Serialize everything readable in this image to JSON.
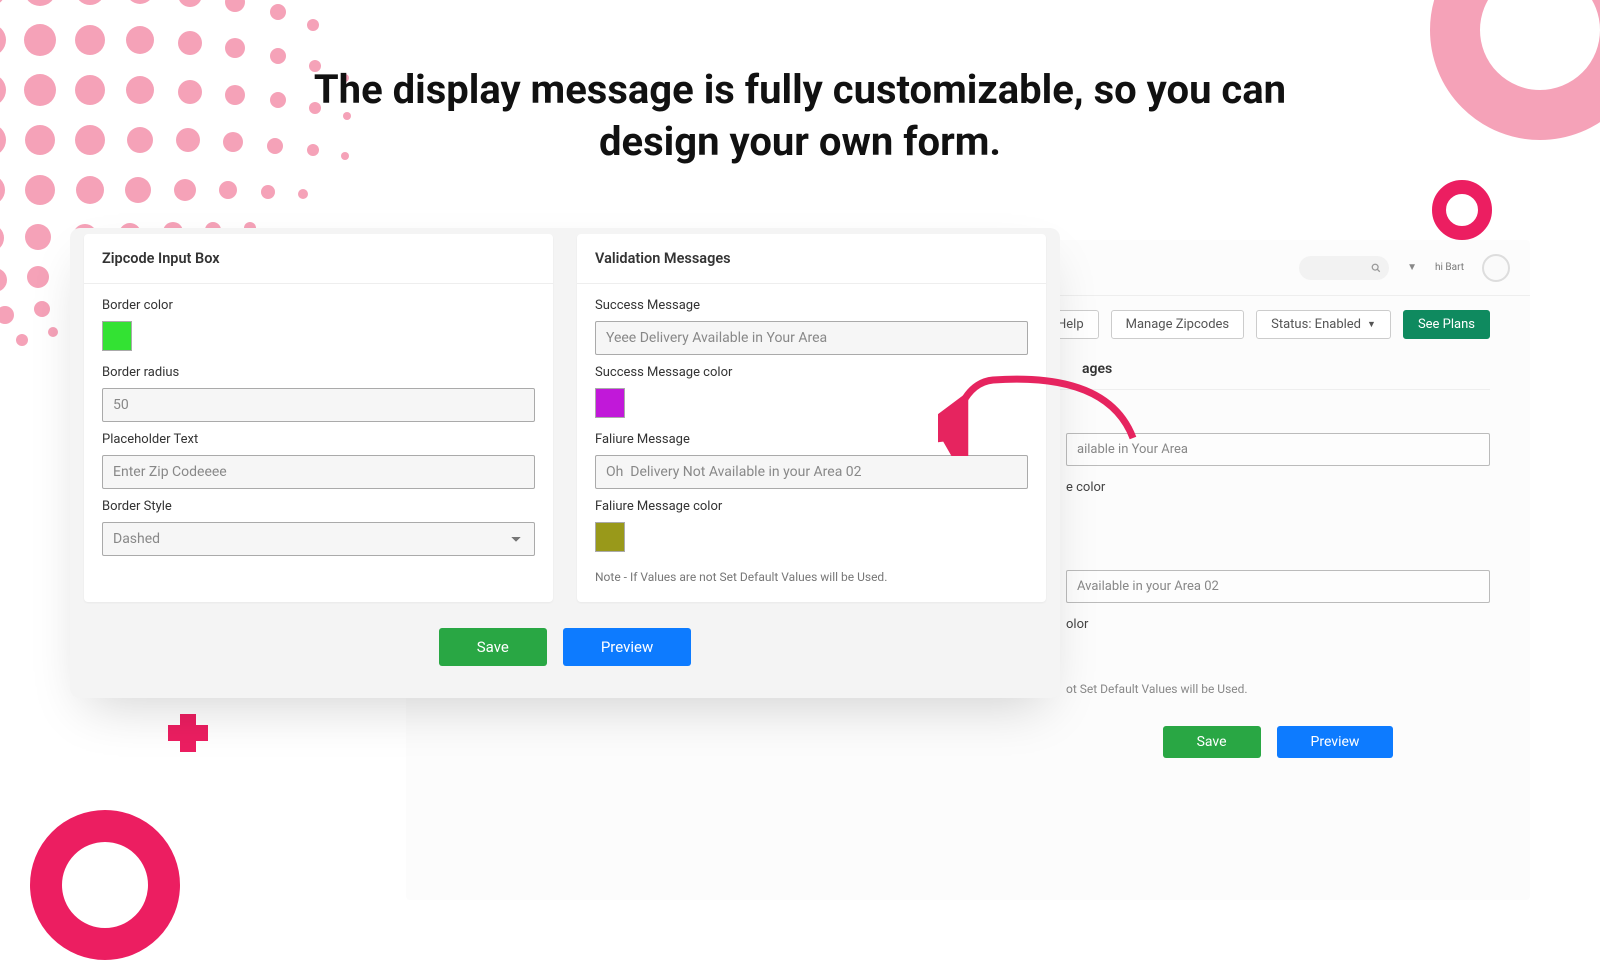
{
  "headline": "The display message is fully customizable, so you can design your own form.",
  "zipbox": {
    "title": "Zipcode Input Box",
    "border_color_label": "Border color",
    "border_color": "#33e233",
    "border_radius_label": "Border radius",
    "border_radius_value": "50",
    "placeholder_label": "Placeholder Text",
    "placeholder_value": "Enter Zip Codeeee",
    "border_style_label": "Border Style",
    "border_style_value": "Dashed"
  },
  "validation": {
    "title": "Validation Messages",
    "success_label": "Success Message",
    "success_value": "Yeee Delivery Available in Your Area",
    "success_color_label": "Success Message color",
    "success_color": "#c118d9",
    "failure_label": "Faliure Message",
    "failure_value": "Oh  Delivery Not Available in your Area 02",
    "failure_color_label": "Faliure Message color",
    "failure_color": "#99991a",
    "note": "Note - If Values are not Set Default Values will be Used."
  },
  "buttons": {
    "save": "Save",
    "preview": "Preview"
  },
  "bg": {
    "help": "Help",
    "manage": "Manage Zipcodes",
    "status": "Status: Enabled",
    "seeplans": "See Plans",
    "header_hint": "hi Bart",
    "card_title": "ages",
    "success_partial": "ailable in Your Area",
    "color_label_partial": "e color",
    "failure_partial": "Available in your Area 02",
    "color2_label_partial": "olor",
    "note_partial": "ot Set Default Values will be Used.",
    "save": "Save",
    "preview": "Preview"
  }
}
